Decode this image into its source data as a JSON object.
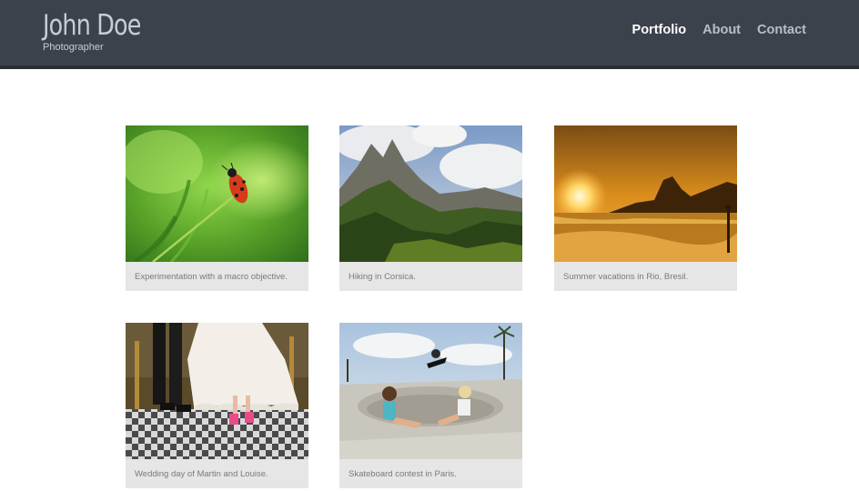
{
  "header": {
    "name": "John Doe",
    "tagline": "Photographer",
    "nav": [
      {
        "label": "Portfolio",
        "active": true
      },
      {
        "label": "About",
        "active": false
      },
      {
        "label": "Contact",
        "active": false
      }
    ]
  },
  "gallery": {
    "items": [
      {
        "caption": "Experimentation with a macro objective.",
        "image": "ladybug-on-grass"
      },
      {
        "caption": "Hiking in Corsica.",
        "image": "green-mountains"
      },
      {
        "caption": "Summer vacations in Rio, Bresil.",
        "image": "sunset-beach"
      },
      {
        "caption": "Wedding day of Martin and Louise.",
        "image": "wedding-couple-feet"
      },
      {
        "caption": "Skateboard contest in Paris.",
        "image": "skatepark"
      }
    ]
  },
  "colors": {
    "header_bg": "#3c424c",
    "nav_active": "#ffffff",
    "nav_inactive": "#b9bec6",
    "caption_bg": "#e6e6e6"
  }
}
